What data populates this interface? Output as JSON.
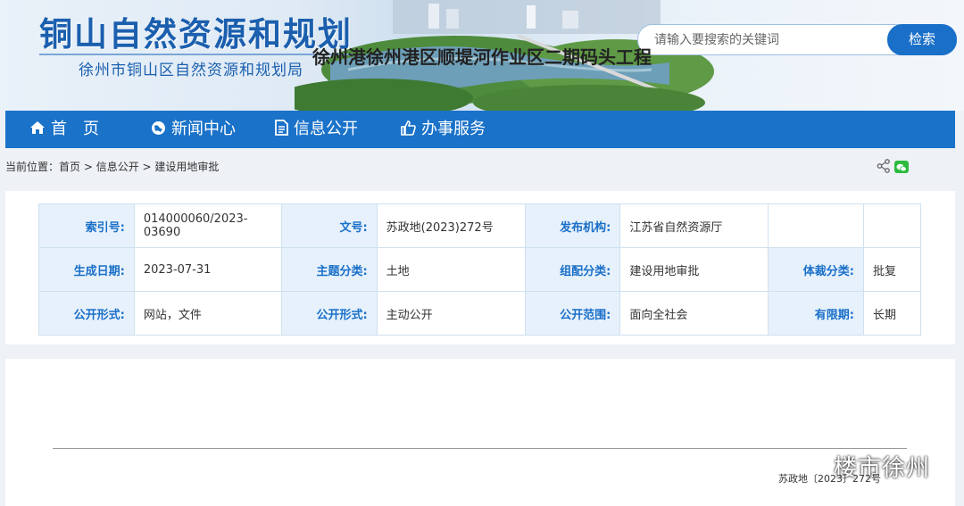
{
  "header": {
    "title": "铜山自然资源和规划",
    "subtitle": "徐州市铜山区自然资源和规划局",
    "search": {
      "placeholder": "请输入要搜索的关键词",
      "button": "检索"
    }
  },
  "nav": [
    {
      "label": "首　页",
      "icon": "home-icon"
    },
    {
      "label": "新闻中心",
      "icon": "globe-icon"
    },
    {
      "label": "信息公开",
      "icon": "document-icon"
    },
    {
      "label": "办事服务",
      "icon": "thumbs-up-icon"
    }
  ],
  "breadcrumb": {
    "prefix": "当前位置：",
    "items": [
      "首页",
      "信息公开",
      "建设用地审批"
    ],
    "sep": " > "
  },
  "share": {
    "icons": [
      "share-icon",
      "wechat-icon"
    ]
  },
  "meta": {
    "rows": [
      [
        {
          "k": "索引号:",
          "v": "014000060/2023-03690"
        },
        {
          "k": "文号:",
          "v": "苏政地(2023)272号"
        },
        {
          "k": "发布机构:",
          "v": "江苏省自然资源厅"
        },
        {
          "k": "",
          "v": ""
        }
      ],
      [
        {
          "k": "生成日期:",
          "v": "2023-07-31"
        },
        {
          "k": "主题分类:",
          "v": "土地"
        },
        {
          "k": "组配分类:",
          "v": "建设用地审批"
        },
        {
          "k": "体裁分类:",
          "v": "批复"
        }
      ],
      [
        {
          "k": "公开形式:",
          "v": "网站，文件"
        },
        {
          "k": "公开形式:",
          "v": "主动公开"
        },
        {
          "k": "公开范围:",
          "v": "面向全社会"
        },
        {
          "k": "有限期:",
          "v": "长期"
        }
      ]
    ]
  },
  "document": {
    "title": "徐州港徐州港区顺堤河作业区二期码头工程",
    "number": "苏政地〔2023〕272号",
    "watermark": "楼市徐州"
  },
  "colors": {
    "brand": "#1a6fc8",
    "nav": "#1a72c9",
    "label_bg": "#e6f1fb"
  }
}
